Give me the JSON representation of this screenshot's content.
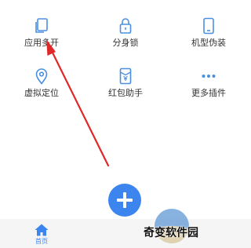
{
  "features": [
    {
      "label": "应用多开",
      "icon": "copy-icon"
    },
    {
      "label": "分身锁",
      "icon": "lock-icon"
    },
    {
      "label": "机型伪装",
      "icon": "phone-icon"
    },
    {
      "label": "虚拟定位",
      "icon": "location-pin-icon"
    },
    {
      "label": "红包助手",
      "icon": "red-packet-icon"
    },
    {
      "label": "更多插件",
      "icon": "more-dots-icon"
    }
  ],
  "tabbar": {
    "home_label": "首页"
  },
  "watermark": {
    "text": "奇变软件园"
  },
  "colors": {
    "accent": "#3d85ee",
    "annotation_arrow": "#e02828",
    "icon": "#4a90e2"
  }
}
